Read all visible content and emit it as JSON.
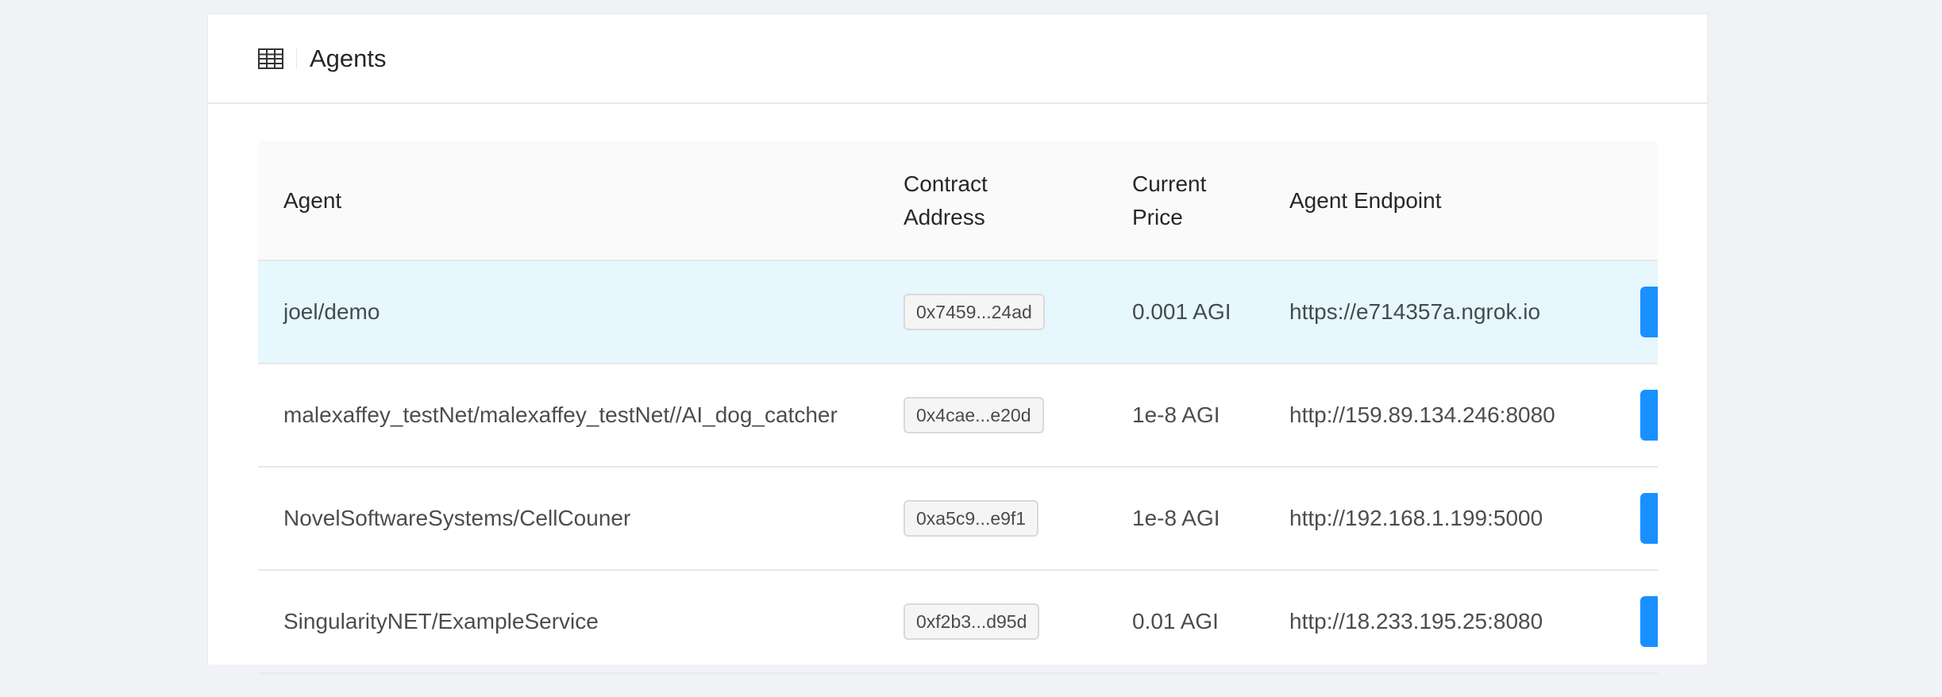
{
  "header": {
    "icon": "table-icon",
    "title": "Agents"
  },
  "table": {
    "columns": {
      "agent": "Agent",
      "contract_line1": "Contract",
      "contract_line2": "Address",
      "price_line1": "Current",
      "price_line2": "Price",
      "endpoint": "Agent Endpoint"
    },
    "rows": [
      {
        "agent": "joel/demo",
        "address": "0x7459...24ad",
        "price": "0.001 AGI",
        "endpoint": "https://e714357a.ngrok.io",
        "highlighted": true
      },
      {
        "agent": "malexaffey_testNet/malexaffey_testNet//AI_dog_catcher",
        "address": "0x4cae...e20d",
        "price": "1e-8 AGI",
        "endpoint": "http://159.89.134.246:8080",
        "highlighted": false
      },
      {
        "agent": "NovelSoftwareSystems/CellCouner",
        "address": "0xa5c9...e9f1",
        "price": "1e-8 AGI",
        "endpoint": "http://192.168.1.199:5000",
        "highlighted": false
      },
      {
        "agent": "SingularityNET/ExampleService",
        "address": "0xf2b3...d95d",
        "price": "0.01 AGI",
        "endpoint": "http://18.233.195.25:8080",
        "highlighted": false
      }
    ]
  },
  "colors": {
    "accent": "#1890ff",
    "row_highlight": "#e6f7fe",
    "background": "#f0f2f5"
  }
}
